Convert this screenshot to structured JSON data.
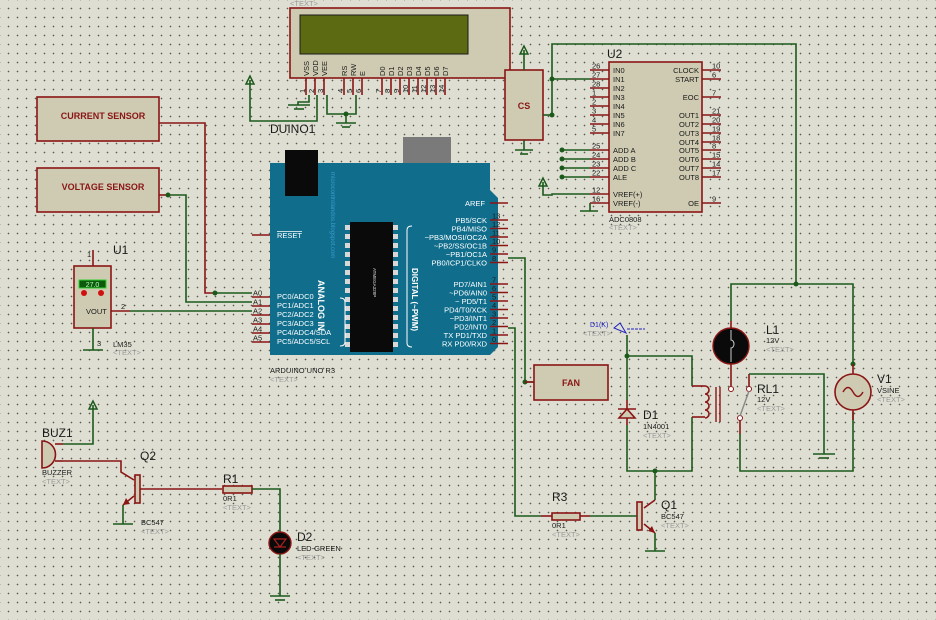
{
  "lcd": {
    "text_tag": "<TEXT>",
    "pins": [
      "VSS",
      "VDD",
      "VEE",
      "RS",
      "RW",
      "E",
      "D0",
      "D1",
      "D2",
      "D3",
      "D4",
      "D5",
      "D6",
      "D7"
    ],
    "pin_numbers": [
      "1",
      "2",
      "3",
      "4",
      "5",
      "6",
      "7",
      "8",
      "9",
      "10",
      "11",
      "12",
      "13",
      "14"
    ],
    "ref": "DUINO1"
  },
  "sensors": {
    "current": "CURRENT SENSOR",
    "voltage": "VOLTAGE SENSOR",
    "cs": "CS",
    "fan": "FAN"
  },
  "u1": {
    "ref": "U1",
    "value": "LM35",
    "text_tag": "<TEXT>",
    "reading": "27.0",
    "vout": "VOUT",
    "pins": [
      "1",
      "2",
      "3"
    ]
  },
  "arduino": {
    "label": "ARDUINO UNO R3",
    "text_tag": "<TEXT>",
    "reset": "RESET",
    "aref": "AREF",
    "analog_title": "ANALOG IN",
    "digital_title": "DIGITAL (~PWM)",
    "watermark": "microcontrolandos.blogspot.com",
    "chip": "ATMEGA328P",
    "analog_pins": [
      {
        "tag": "A0",
        "name": "PC0/ADC0"
      },
      {
        "tag": "A1",
        "name": "PC1/ADC1"
      },
      {
        "tag": "A2",
        "name": "PC2/ADC2"
      },
      {
        "tag": "A3",
        "name": "PC3/ADC3"
      },
      {
        "tag": "A4",
        "name": "PC4/ADC4/SDA"
      },
      {
        "tag": "A5",
        "name": "PC5/ADC5/SCL"
      }
    ],
    "digital_pins_b": [
      {
        "no": "13",
        "name": "PB5/SCK"
      },
      {
        "no": "12",
        "name": "PB4/MISO"
      },
      {
        "no": "11",
        "name": "~PB3/MOSI/OC2A"
      },
      {
        "no": "10",
        "name": "~PB2/SS/OC1B"
      },
      {
        "no": "9",
        "name": "~PB1/OC1A"
      },
      {
        "no": "8",
        "name": "PB0/ICP1/CLKO"
      }
    ],
    "digital_pins_d": [
      {
        "no": "7",
        "name": "PD7/AIN1"
      },
      {
        "no": "6",
        "name": "~PD6/AIN0"
      },
      {
        "no": "5",
        "name": "~ PD5/T1"
      },
      {
        "no": "4",
        "name": "PD4/T0/XCK"
      },
      {
        "no": "3",
        "name": "~PD3/INT1"
      },
      {
        "no": "2",
        "name": "PD2/INT0"
      },
      {
        "no": "1",
        "name": "TX PD1/TXD"
      },
      {
        "no": "0",
        "name": "RX PD0/RXD"
      }
    ]
  },
  "u2": {
    "ref": "U2",
    "value": "ADC0808",
    "text_tag": "<TEXT>",
    "left_pins": [
      {
        "no": "26",
        "name": "IN0"
      },
      {
        "no": "27",
        "name": "IN1"
      },
      {
        "no": "28",
        "name": "IN2"
      },
      {
        "no": "1",
        "name": "IN3"
      },
      {
        "no": "2",
        "name": "IN4"
      },
      {
        "no": "3",
        "name": "IN5"
      },
      {
        "no": "4",
        "name": "IN6"
      },
      {
        "no": "5",
        "name": "IN7"
      },
      {
        "no": "25",
        "name": "ADD A"
      },
      {
        "no": "24",
        "name": "ADD B"
      },
      {
        "no": "23",
        "name": "ADD C"
      },
      {
        "no": "22",
        "name": "ALE"
      },
      {
        "no": "12",
        "name": "VREF(+)"
      },
      {
        "no": "16",
        "name": "VREF(-)"
      }
    ],
    "right_pins": [
      {
        "no": "10",
        "name": "CLOCK"
      },
      {
        "no": "6",
        "name": "START"
      },
      {
        "no": "7",
        "name": "EOC"
      },
      {
        "no": "21",
        "name": "OUT1"
      },
      {
        "no": "20",
        "name": "OUT2"
      },
      {
        "no": "19",
        "name": "OUT3"
      },
      {
        "no": "18",
        "name": "OUT4"
      },
      {
        "no": "8",
        "name": "OUT5"
      },
      {
        "no": "15",
        "name": "OUT6"
      },
      {
        "no": "14",
        "name": "OUT7"
      },
      {
        "no": "17",
        "name": "OUT8"
      },
      {
        "no": "9",
        "name": "OE"
      }
    ]
  },
  "buz1": {
    "ref": "BUZ1",
    "value": "BUZZER",
    "text_tag": "<TEXT>"
  },
  "q2": {
    "ref": "Q2",
    "value": "BC547",
    "text_tag": "<TEXT>"
  },
  "r1": {
    "ref": "R1",
    "value": "0R1",
    "text_tag": "<TEXT>"
  },
  "d2": {
    "ref": "D2",
    "value": "LED-GREEN",
    "text_tag": "<TEXT>"
  },
  "d1": {
    "ref": "D1",
    "value": "1N4001",
    "text_tag": "<TEXT>",
    "probe": "D1(K)",
    "probe_text": "<TEXT>"
  },
  "r3": {
    "ref": "R3",
    "value": "0R1",
    "text_tag": "<TEXT>"
  },
  "q1": {
    "ref": "Q1",
    "value": "BC547",
    "text_tag": "<TEXT>"
  },
  "l1": {
    "ref": "L1",
    "value": "12V",
    "text_tag": "<TEXT>"
  },
  "rl1": {
    "ref": "RL1",
    "value": "12V",
    "text_tag": "<TEXT>"
  },
  "v1": {
    "ref": "V1",
    "value": "VSINE",
    "text_tag": "<TEXT>"
  }
}
